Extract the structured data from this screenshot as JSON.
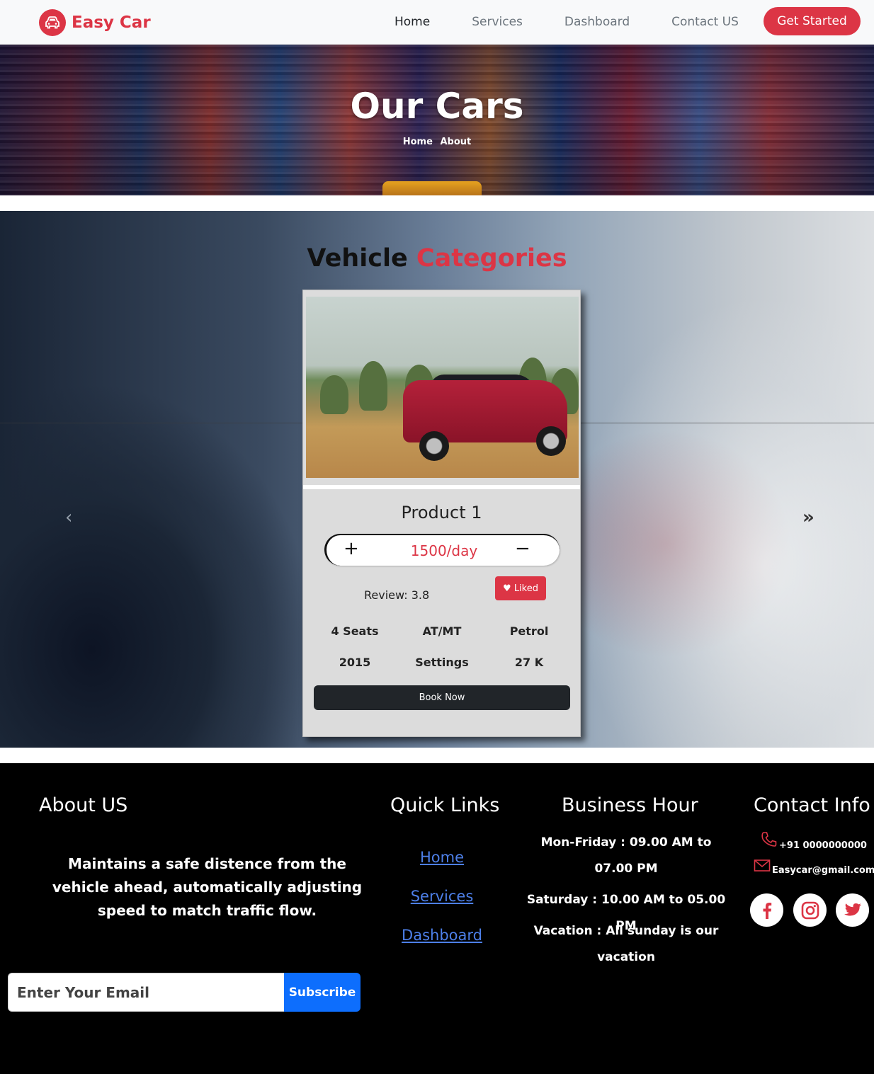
{
  "navbar": {
    "brand": "Easy Car",
    "links": [
      "Home",
      "Services",
      "Dashboard",
      "Contact US"
    ],
    "cta": "Get Started"
  },
  "hero": {
    "title": "Our Cars",
    "breadcrumb": [
      "Home",
      "About"
    ]
  },
  "section": {
    "title_dark": "Vehicle",
    "title_accent": "Categories",
    "accent_color": "#dc3545"
  },
  "card": {
    "name": "Product 1",
    "price": "1500/day",
    "plus": "+",
    "minus": "−",
    "review": "Review: 3.8",
    "like_label": "Liked",
    "specs_row1": [
      "4 Seats",
      "AT/MT",
      "Petrol"
    ],
    "specs_row2": [
      "2015",
      "Settings",
      "27 K"
    ],
    "book_label": "Book Now"
  },
  "footer": {
    "about_heading": "About US",
    "about_text": "Maintains a safe distence from the vehicle ahead, automatically adjusting speed to match traffic flow.",
    "email_placeholder": "Enter Your Email",
    "subscribe_label": "Subscribe",
    "quick_heading": "Quick Links",
    "quick_links": [
      "Home",
      "Services",
      "Dashboard"
    ],
    "hours_heading": "Business Hour",
    "hours": [
      "Mon-Friday : 09.00 AM to 07.00 PM",
      "Saturday : 10.00 AM to 05.00 PM",
      "Vacation : All sunday is our vacation"
    ],
    "contact_heading": "Contact Info",
    "phone": "+91 0000000000",
    "email": "Easycar@gmail.com",
    "social_icons": [
      "facebook-icon",
      "instagram-icon",
      "twitter-icon"
    ]
  }
}
